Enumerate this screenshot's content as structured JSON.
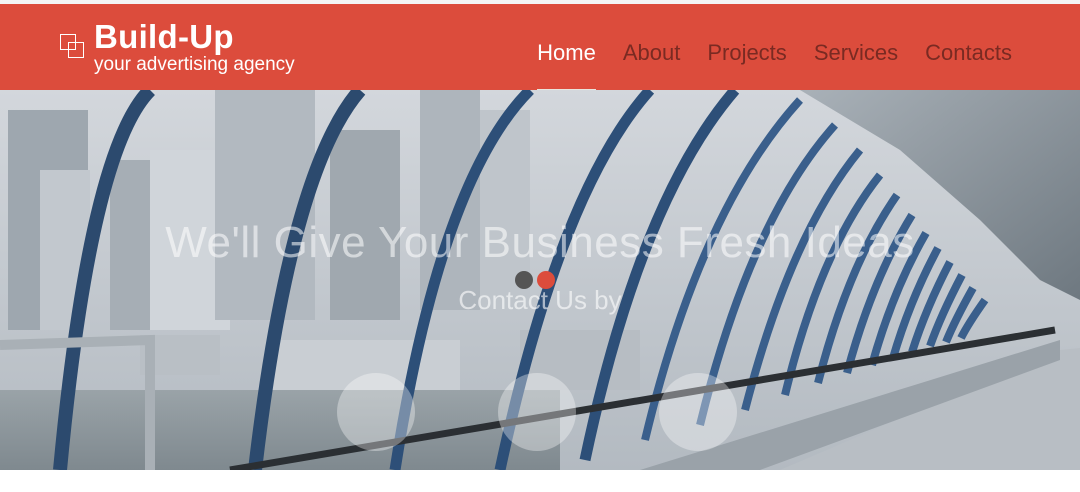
{
  "brand": {
    "name": "Build-Up",
    "tagline": "your advertising agency"
  },
  "nav": {
    "items": [
      {
        "label": "Home",
        "active": true
      },
      {
        "label": "About",
        "active": false
      },
      {
        "label": "Projects",
        "active": false
      },
      {
        "label": "Services",
        "active": false
      },
      {
        "label": "Contacts",
        "active": false
      }
    ]
  },
  "hero": {
    "title": "We'll Give Your Business Fresh Ideas",
    "subtitle": "Contact Us by",
    "slides": 2,
    "active_slide": 2,
    "background": "glass tunnel walkway over river with city skyline"
  },
  "colors": {
    "accent": "#dc4c3c",
    "nav_inactive": "#7a2a22",
    "dot_inactive": "#555555"
  },
  "icons": {
    "logo": "overlapping-squares-icon"
  }
}
